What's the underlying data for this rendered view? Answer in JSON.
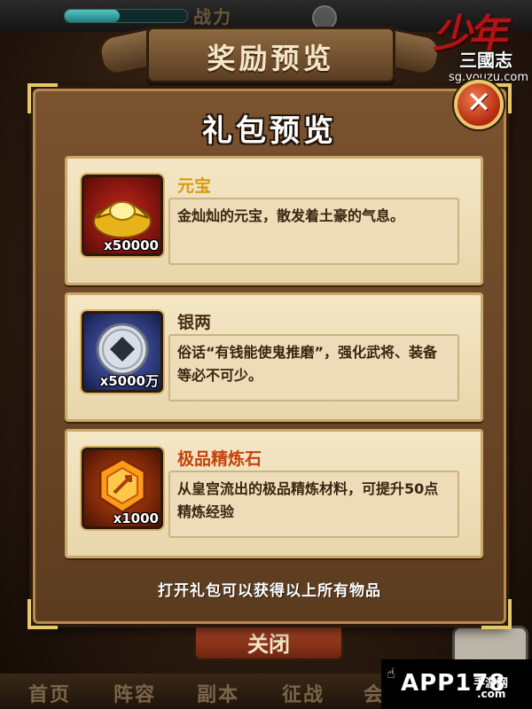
{
  "background": {
    "power_label": "战力",
    "power_fill": 0.45,
    "title": "奖励预览",
    "close_button_label": "关闭",
    "nav_items": [
      "首页",
      "阵容",
      "副本",
      "征战",
      "会"
    ]
  },
  "logo": {
    "title": "少年",
    "subtitle": "三國志",
    "url": "sg.youzu.com"
  },
  "watermark": {
    "brand": "APP178",
    "sub1": "手游网",
    "sub2": ".com"
  },
  "modal": {
    "title": "礼包预览",
    "close_icon": "x-icon",
    "footer": "打开礼包可以获得以上所有物品",
    "items": [
      {
        "name": "元宝",
        "name_color": "#d99a12",
        "quantity": "x50000",
        "icon": "gold-ingot-icon",
        "description": "金灿灿的元宝，散发着土豪的气息。"
      },
      {
        "name": "银两",
        "name_color": "#4a2e14",
        "quantity": "x5000万",
        "icon": "silver-coin-icon",
        "description": "俗话“有钱能使鬼推磨”，强化武将、装备等必不可少。"
      },
      {
        "name": "极品精炼石",
        "name_color": "#c6420e",
        "quantity": "x1000",
        "icon": "refine-stone-icon",
        "description": "从皇宫流出的极品精炼材料，可提升50点精炼经验"
      }
    ]
  }
}
